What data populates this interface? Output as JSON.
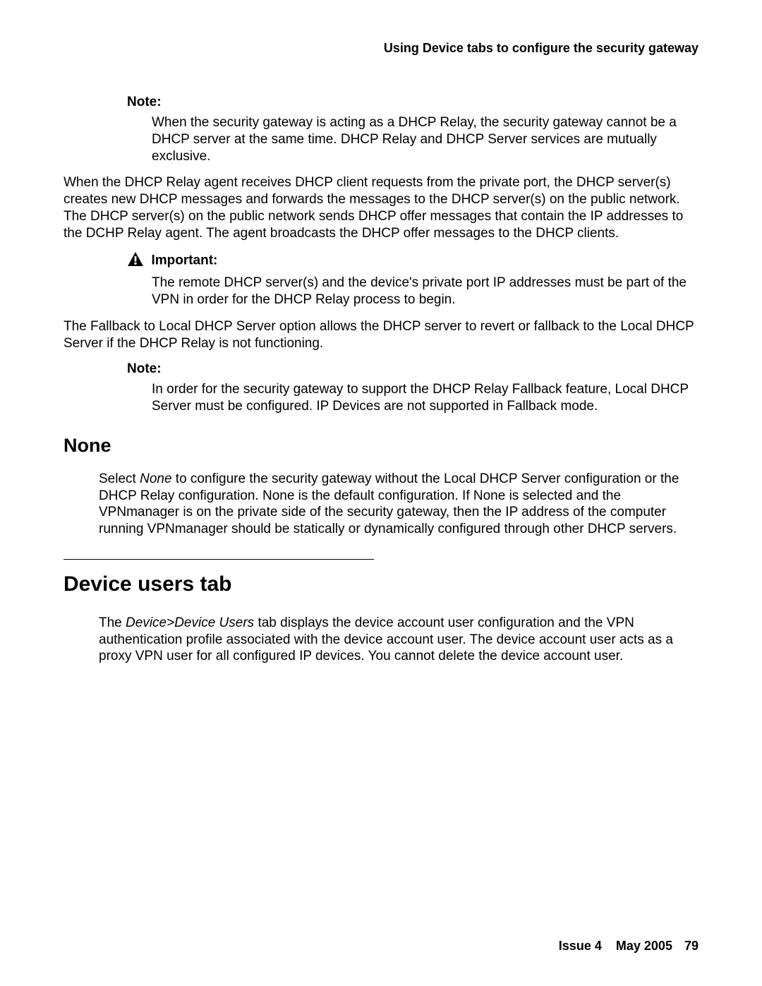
{
  "header": {
    "running_title": "Using Device tabs to configure the security gateway"
  },
  "blocks": {
    "note1_label": "Note:",
    "note1_body": "When the security gateway is acting as a DHCP Relay, the security gateway cannot be a DHCP server at the same time. DHCP Relay and DHCP Server services are mutually exclusive.",
    "para1": "When the DHCP Relay agent receives DHCP client requests from the private port, the DHCP server(s) creates new DHCP messages and forwards the messages to the DHCP server(s) on the public network. The DHCP server(s) on the public network sends DHCP offer messages that contain the IP addresses to the DCHP Relay agent. The agent broadcasts the DHCP offer messages to the DHCP clients.",
    "important_label": "Important:",
    "important_body": "The remote DHCP server(s) and the device's private port IP addresses must be part of the VPN in order for the DHCP Relay process to begin.",
    "para2": "The Fallback to Local DHCP Server option allows the DHCP server to revert or fallback to the Local DHCP Server if the DHCP Relay is not functioning.",
    "note2_label": "Note:",
    "note2_body": "In order for the security gateway to support the DHCP Relay Fallback feature, Local DHCP Server must be configured. IP Devices are not supported in Fallback mode.",
    "none_heading": "None",
    "none_para_prefix": "Select ",
    "none_para_italic": "None",
    "none_para_rest": " to configure the security gateway without the Local DHCP Server configuration or the DHCP Relay configuration. None is the default configuration. If None is selected and the VPNmanager is on the private side of the security gateway, then the IP address of the computer running VPNmanager should be statically or dynamically configured through other DHCP servers.",
    "device_users_heading": "Device users tab",
    "device_users_para_prefix": "The ",
    "device_users_para_italic": "Device>Device Users",
    "device_users_para_rest": " tab displays the device account user configuration and the VPN authentication profile associated with the device account user. The device account user acts as a proxy VPN user for all configured IP devices. You cannot delete the device account user."
  },
  "footer": {
    "issue": "Issue 4",
    "date": "May 2005",
    "page": "79"
  }
}
